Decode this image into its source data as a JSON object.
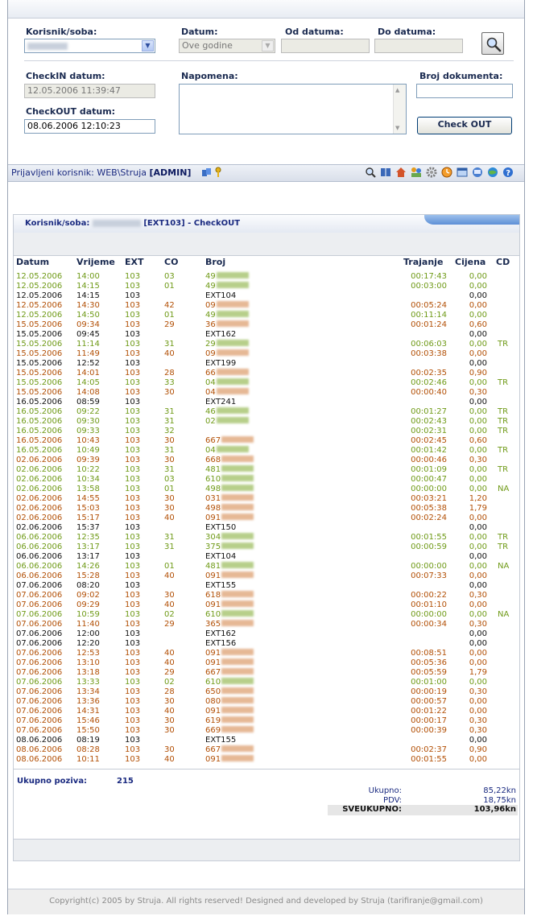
{
  "filters": {
    "user_room_label": "Korisnik/soba:",
    "date_label": "Datum:",
    "date_value": "Ove godine",
    "from_label": "Od datuma:",
    "to_label": "Do datuma:",
    "checkin_label": "CheckIN datum:",
    "checkin_value": "12.05.2006 11:39:47",
    "checkout_label": "CheckOUT datum:",
    "checkout_value": "08.06.2006 12:10:23",
    "note_label": "Napomena:",
    "doc_label": "Broj dokumenta:",
    "checkout_button": "Check OUT"
  },
  "userbar": {
    "prefix": "Prijavljeni korisnik: WEB\\Struja",
    "role": "[ADMIN]"
  },
  "panel": {
    "title_prefix": "Korisnik/soba:",
    "title_suffix": "[EXT103] - CheckOUT"
  },
  "table": {
    "headers": [
      "Datum",
      "Vrijeme",
      "EXT",
      "CO",
      "Broj",
      "Trajanje",
      "Cijena",
      "CD"
    ],
    "rows": [
      [
        "12.05.2006",
        "14:00",
        "103",
        "03",
        "49",
        "00:17:43",
        "0,00",
        "",
        "g"
      ],
      [
        "12.05.2006",
        "14:15",
        "103",
        "01",
        "49",
        "00:03:00",
        "0,00",
        "",
        "g"
      ],
      [
        "12.05.2006",
        "14:15",
        "103",
        "",
        "EXT104",
        "",
        "0,00",
        "",
        "k"
      ],
      [
        "12.05.2006",
        "14:30",
        "103",
        "42",
        "09",
        "00:05:24",
        "0,00",
        "",
        "o"
      ],
      [
        "12.05.2006",
        "14:50",
        "103",
        "01",
        "49",
        "00:11:14",
        "0,00",
        "",
        "g"
      ],
      [
        "15.05.2006",
        "09:34",
        "103",
        "29",
        "36",
        "00:01:24",
        "0,60",
        "",
        "o"
      ],
      [
        "15.05.2006",
        "09:45",
        "103",
        "",
        "EXT162",
        "",
        "0,00",
        "",
        "k"
      ],
      [
        "15.05.2006",
        "11:14",
        "103",
        "31",
        "29",
        "00:06:03",
        "0,00",
        "TR",
        "g"
      ],
      [
        "15.05.2006",
        "11:49",
        "103",
        "40",
        "09",
        "00:03:38",
        "0,00",
        "",
        "o"
      ],
      [
        "15.05.2006",
        "12:52",
        "103",
        "",
        "EXT199",
        "",
        "0,00",
        "",
        "k"
      ],
      [
        "15.05.2006",
        "14:01",
        "103",
        "28",
        "66",
        "00:02:35",
        "0,90",
        "",
        "o"
      ],
      [
        "15.05.2006",
        "14:05",
        "103",
        "33",
        "04",
        "00:02:46",
        "0,00",
        "TR",
        "g"
      ],
      [
        "15.05.2006",
        "14:08",
        "103",
        "30",
        "04",
        "00:00:40",
        "0,30",
        "",
        "o"
      ],
      [
        "16.05.2006",
        "08:59",
        "103",
        "",
        "EXT241",
        "",
        "0,00",
        "",
        "k"
      ],
      [
        "16.05.2006",
        "09:22",
        "103",
        "31",
        "46",
        "00:01:27",
        "0,00",
        "TR",
        "g"
      ],
      [
        "16.05.2006",
        "09:30",
        "103",
        "31",
        "02",
        "00:02:43",
        "0,00",
        "TR",
        "g"
      ],
      [
        "16.05.2006",
        "09:33",
        "103",
        "32",
        "",
        "00:02:31",
        "0,00",
        "TR",
        "g"
      ],
      [
        "16.05.2006",
        "10:43",
        "103",
        "30",
        "667",
        "00:02:45",
        "0,60",
        "",
        "o"
      ],
      [
        "16.05.2006",
        "10:49",
        "103",
        "31",
        "04",
        "00:01:42",
        "0,00",
        "TR",
        "g"
      ],
      [
        "02.06.2006",
        "09:39",
        "103",
        "30",
        "668",
        "00:00:46",
        "0,30",
        "",
        "o"
      ],
      [
        "02.06.2006",
        "10:22",
        "103",
        "31",
        "481",
        "00:01:09",
        "0,00",
        "TR",
        "g"
      ],
      [
        "02.06.2006",
        "10:34",
        "103",
        "03",
        "610",
        "00:00:47",
        "0,00",
        "",
        "g"
      ],
      [
        "02.06.2006",
        "13:58",
        "103",
        "01",
        "498",
        "00:00:00",
        "0,00",
        "NA",
        "g"
      ],
      [
        "02.06.2006",
        "14:55",
        "103",
        "30",
        "031",
        "00:03:21",
        "1,20",
        "",
        "o"
      ],
      [
        "02.06.2006",
        "15:03",
        "103",
        "30",
        "498",
        "00:05:38",
        "1,79",
        "",
        "o"
      ],
      [
        "02.06.2006",
        "15:17",
        "103",
        "40",
        "091",
        "00:02:24",
        "0,00",
        "",
        "o"
      ],
      [
        "02.06.2006",
        "15:37",
        "103",
        "",
        "EXT150",
        "",
        "0,00",
        "",
        "k"
      ],
      [
        "06.06.2006",
        "12:35",
        "103",
        "31",
        "304",
        "00:01:55",
        "0,00",
        "TR",
        "g"
      ],
      [
        "06.06.2006",
        "13:17",
        "103",
        "31",
        "375",
        "00:00:59",
        "0,00",
        "TR",
        "g"
      ],
      [
        "06.06.2006",
        "13:17",
        "103",
        "",
        "EXT104",
        "",
        "0,00",
        "",
        "k"
      ],
      [
        "06.06.2006",
        "14:26",
        "103",
        "01",
        "481",
        "00:00:00",
        "0,00",
        "NA",
        "g"
      ],
      [
        "06.06.2006",
        "15:28",
        "103",
        "40",
        "091",
        "00:07:33",
        "0,00",
        "",
        "o"
      ],
      [
        "07.06.2006",
        "08:20",
        "103",
        "",
        "EXT155",
        "",
        "0,00",
        "",
        "k"
      ],
      [
        "07.06.2006",
        "09:02",
        "103",
        "30",
        "618",
        "00:00:22",
        "0,30",
        "",
        "o"
      ],
      [
        "07.06.2006",
        "09:29",
        "103",
        "40",
        "091",
        "00:01:10",
        "0,00",
        "",
        "o"
      ],
      [
        "07.06.2006",
        "10:59",
        "103",
        "02",
        "610",
        "00:00:00",
        "0,00",
        "NA",
        "g"
      ],
      [
        "07.06.2006",
        "11:40",
        "103",
        "29",
        "365",
        "00:00:34",
        "0,30",
        "",
        "o"
      ],
      [
        "07.06.2006",
        "12:00",
        "103",
        "",
        "EXT162",
        "",
        "0,00",
        "",
        "k"
      ],
      [
        "07.06.2006",
        "12:20",
        "103",
        "",
        "EXT156",
        "",
        "0,00",
        "",
        "k"
      ],
      [
        "07.06.2006",
        "12:53",
        "103",
        "40",
        "091",
        "00:08:51",
        "0,00",
        "",
        "o"
      ],
      [
        "07.06.2006",
        "13:10",
        "103",
        "40",
        "091",
        "00:05:36",
        "0,00",
        "",
        "o"
      ],
      [
        "07.06.2006",
        "13:18",
        "103",
        "29",
        "667",
        "00:05:59",
        "1,79",
        "",
        "o"
      ],
      [
        "07.06.2006",
        "13:33",
        "103",
        "02",
        "610",
        "00:01:00",
        "0,00",
        "",
        "g"
      ],
      [
        "07.06.2006",
        "13:34",
        "103",
        "28",
        "650",
        "00:00:19",
        "0,30",
        "",
        "o"
      ],
      [
        "07.06.2006",
        "13:36",
        "103",
        "30",
        "080",
        "00:00:57",
        "0,00",
        "",
        "o"
      ],
      [
        "07.06.2006",
        "14:31",
        "103",
        "40",
        "091",
        "00:01:22",
        "0,00",
        "",
        "o"
      ],
      [
        "07.06.2006",
        "15:46",
        "103",
        "30",
        "619",
        "00:00:17",
        "0,30",
        "",
        "o"
      ],
      [
        "07.06.2006",
        "15:50",
        "103",
        "30",
        "669",
        "00:00:39",
        "0,30",
        "",
        "o"
      ],
      [
        "08.06.2006",
        "08:19",
        "103",
        "",
        "EXT155",
        "",
        "0,00",
        "",
        "k"
      ],
      [
        "08.06.2006",
        "08:28",
        "103",
        "30",
        "667",
        "00:02:37",
        "0,90",
        "",
        "o"
      ],
      [
        "08.06.2006",
        "10:11",
        "103",
        "40",
        "091",
        "00:01:55",
        "0,00",
        "",
        "o"
      ]
    ]
  },
  "totals": {
    "calls_label": "Ukupno poziva:",
    "calls_value": "215",
    "ukupno_label": "Ukupno:",
    "ukupno_value": "85,22kn",
    "pdv_label": "PDV:",
    "pdv_value": "18,75kn",
    "sveukupno_label": "SVEUKUPNO:",
    "sveukupno_value": "103,96kn"
  },
  "footer": {
    "text": "Copyright(c) 2005 by Struja. All rights reserved! Designed and developed by Struja (tarifiranje@gmail.com)"
  },
  "colors": {
    "green": "#6f9a17",
    "orange": "#b24f05",
    "label_blue": "#1a2a50",
    "link_blue": "#1a2a80"
  },
  "icons": [
    "search-icon",
    "users-key-icon",
    "key-icon",
    "book-icon",
    "home-icon",
    "people-icon",
    "gear-icon",
    "clock-icon",
    "window-icon",
    "computer-icon",
    "globe-icon",
    "help-icon"
  ]
}
